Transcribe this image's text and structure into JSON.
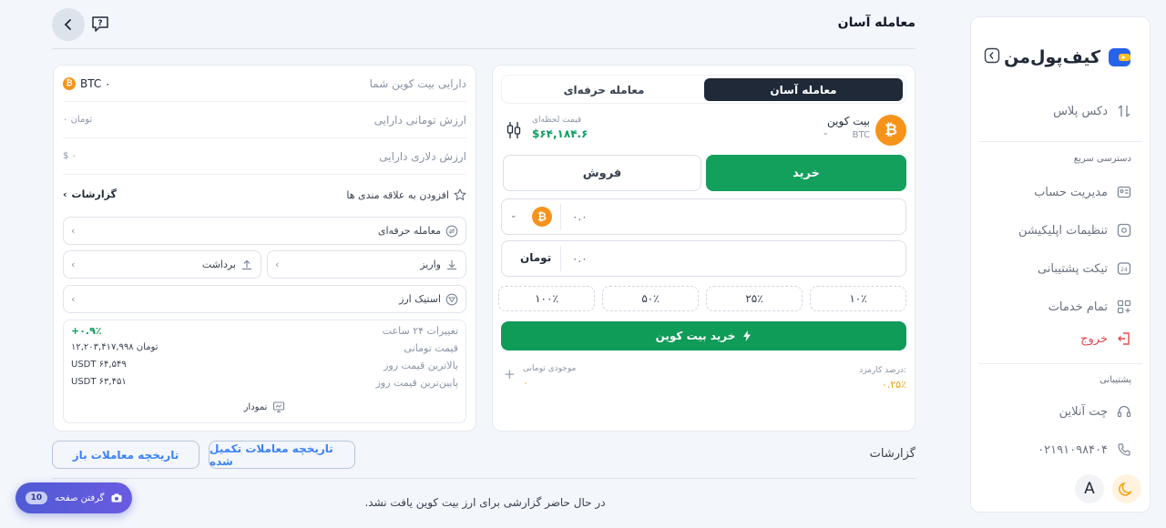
{
  "header": {
    "title": "معامله آسان"
  },
  "sidebar": {
    "logo_text": "کیف‌پول‌من",
    "dex": "دکس پلاس",
    "quick_access": "دسترسی سریع",
    "items": [
      {
        "label": "مدیریت حساب"
      },
      {
        "label": "تنظیمات اپلیکیشن"
      },
      {
        "label": "تیکت پشتیبانی"
      },
      {
        "label": "تمام خدمات"
      },
      {
        "label": "خروج"
      }
    ],
    "support_head": "پشتیبانی",
    "chat": "چت آنلاین",
    "phone": "۰۲۱۹۱۰۹۸۴۰۴",
    "font_toggle": "A"
  },
  "trade": {
    "tab_easy": "معامله آسان",
    "tab_pro": "معامله حرفه‌ای",
    "coin_name": "بیت کوین",
    "coin_symbol": "BTC",
    "live_price_label": "قیمت لحظه‌ای",
    "live_price": "$۶۴,۱۸۴.۶",
    "buy": "خرید",
    "sell": "فروش",
    "amount_placeholder": "۰.۰",
    "toman_placeholder": "۰.۰",
    "toman_unit": "تومان",
    "pct": [
      "۱۰٪",
      "۲۵٪",
      "۵۰٪",
      "۱۰۰٪"
    ],
    "cta": "خرید بیت کوین",
    "fee_label": "درصد کارمزد:",
    "fee_value": "۰.۲۵٪",
    "balance_label": "موجودی تومانی",
    "balance_value": "۰"
  },
  "assets": {
    "btc_label": "دارایی بیت کوین شما",
    "btc_value": "BTC ۰",
    "toman_label": "ارزش تومانی دارایی",
    "toman_value": "۰ تومان",
    "usd_label": "ارزش دلاری دارایی",
    "usd_value": "$ ۰",
    "fav": "افزودن به علاقه مندی ها",
    "reports": "گزارشات",
    "pro_trade": "معامله حرفه‌ای",
    "deposit": "واریز",
    "withdraw": "برداشت",
    "staking": "استیک ارز",
    "stats": [
      {
        "label": "تغییرات ۲۴ ساعت",
        "value": "+۰.۹٪"
      },
      {
        "label": "قیمت تومانی",
        "value": "۱۲,۲۰۳,۴۱۷,۹۹۸ تومان"
      },
      {
        "label": "بالاترین قیمت روز",
        "value": "USDT ۶۴,۵۴۹"
      },
      {
        "label": "پایین‌ترین قیمت روز",
        "value": "USDT ۶۳,۴۵۱"
      }
    ],
    "chart": "نمودار"
  },
  "history": {
    "title": "گزارشات",
    "completed": "تاریخچه معاملات تکمیل شده",
    "open": "تاریخچه معاملات باز",
    "empty": "در حال حاضر گزارشی برای ارز بیت کوین یافت نشد."
  },
  "fab": {
    "label": "گرفتن صفحه",
    "count": "10"
  },
  "colors": {
    "primary": "#12a05c",
    "dark": "#1f2937",
    "accent": "#4f5bd5",
    "btc": "#f7931a"
  }
}
